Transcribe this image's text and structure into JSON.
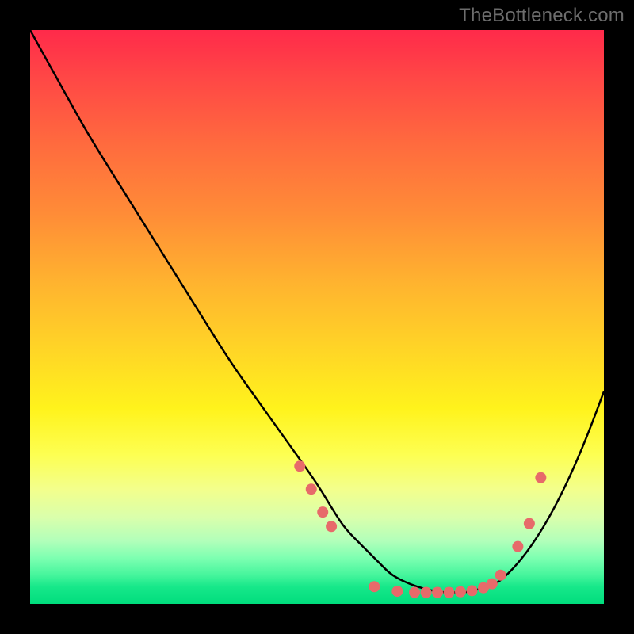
{
  "watermark": "TheBottleneck.com",
  "chart_data": {
    "type": "line",
    "title": "",
    "xlabel": "",
    "ylabel": "",
    "xlim": [
      0,
      100
    ],
    "ylim": [
      0,
      100
    ],
    "grid": false,
    "line_color": "#000000",
    "marker_color": "#e76a6a",
    "background_gradient": {
      "top": "#ff2a4a",
      "mid1": "#ffb32f",
      "mid2": "#fff31c",
      "bottom": "#00dd7d"
    },
    "x": [
      0,
      5,
      10,
      15,
      20,
      25,
      30,
      35,
      40,
      45,
      50,
      53,
      55,
      58,
      61,
      63,
      66,
      69,
      72,
      74,
      76,
      78,
      80,
      82,
      85,
      88,
      91,
      94,
      97,
      100
    ],
    "y": [
      100,
      91,
      82,
      74,
      66,
      58,
      50,
      42,
      35,
      28,
      21,
      16,
      13,
      10,
      7,
      5,
      3.5,
      2.5,
      2,
      2,
      2,
      2.5,
      3,
      4,
      7,
      11,
      16,
      22,
      29,
      37
    ],
    "marked_points": [
      {
        "x": 47,
        "y": 24
      },
      {
        "x": 49,
        "y": 20
      },
      {
        "x": 51,
        "y": 16
      },
      {
        "x": 52.5,
        "y": 13.5
      },
      {
        "x": 60,
        "y": 3
      },
      {
        "x": 64,
        "y": 2.2
      },
      {
        "x": 67,
        "y": 2
      },
      {
        "x": 69,
        "y": 2
      },
      {
        "x": 71,
        "y": 2
      },
      {
        "x": 73,
        "y": 2
      },
      {
        "x": 75,
        "y": 2.1
      },
      {
        "x": 77,
        "y": 2.3
      },
      {
        "x": 79,
        "y": 2.8
      },
      {
        "x": 80.5,
        "y": 3.5
      },
      {
        "x": 82,
        "y": 5
      },
      {
        "x": 85,
        "y": 10
      },
      {
        "x": 87,
        "y": 14
      },
      {
        "x": 89,
        "y": 22
      }
    ]
  }
}
